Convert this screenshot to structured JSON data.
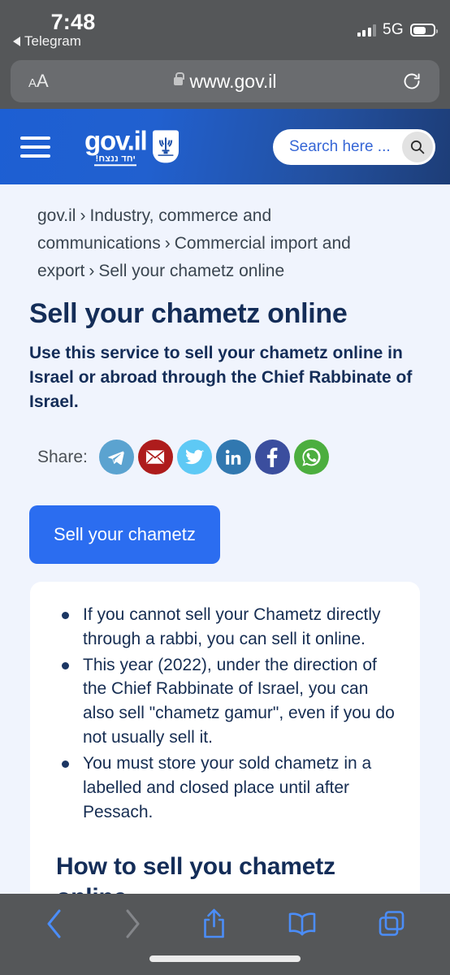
{
  "status_bar": {
    "time": "7:48",
    "back_app_label": "Telegram",
    "back_app_icon": "triangle-left-icon",
    "signal_icon": "cellular-signal-icon",
    "network": "5G",
    "battery_icon": "battery-icon",
    "battery_level_percent": 58
  },
  "browser": {
    "text_size_small": "A",
    "text_size_large": "A",
    "lock_icon": "lock-icon",
    "url": "www.gov.il",
    "reload_icon": "reload-icon",
    "toolbar": {
      "back_icon": "chevron-left-icon",
      "forward_icon": "chevron-right-icon",
      "share_icon": "share-icon",
      "bookmarks_icon": "book-icon",
      "tabs_icon": "tabs-icon"
    },
    "colors": {
      "chrome_bg": "#555759",
      "accent": "#4b8df8",
      "disabled": "#8b8d8f"
    }
  },
  "site_header": {
    "menu_icon": "hamburger-menu-icon",
    "logo_text": "gov.il",
    "logo_subtext": "יחד ננצח!",
    "emblem_icon": "israel-emblem-icon",
    "search_placeholder": "Search here ...",
    "search_icon": "search-icon",
    "gradient_from": "#1d5fd3",
    "gradient_to": "#1d3d77"
  },
  "breadcrumb": {
    "separator": "›",
    "items": [
      {
        "label": "gov.il"
      },
      {
        "label": "Industry, commerce and communications"
      },
      {
        "label": "Commercial import and export"
      },
      {
        "label": "Sell your chametz online"
      }
    ]
  },
  "main": {
    "title": "Sell your chametz online",
    "description": "Use this service to sell your chametz online in Israel or abroad through the Chief Rabbinate of Israel.",
    "share": {
      "label": "Share:",
      "items": [
        {
          "name": "telegram",
          "icon": "telegram-icon",
          "color": "#5ba3d0"
        },
        {
          "name": "email",
          "icon": "email-icon",
          "color": "#ae1c1c"
        },
        {
          "name": "twitter",
          "icon": "twitter-icon",
          "color": "#5ec9f5"
        },
        {
          "name": "linkedin",
          "icon": "linkedin-icon",
          "color": "#3178b0"
        },
        {
          "name": "facebook",
          "icon": "facebook-icon",
          "color": "#3b4e9e"
        },
        {
          "name": "whatsapp",
          "icon": "whatsapp-icon",
          "color": "#4cae3f"
        }
      ]
    },
    "cta_label": "Sell your chametz",
    "cta_color": "#2b6df0",
    "card": {
      "bullets": [
        "If you cannot sell your Chametz directly through a rabbi, you can sell it online.",
        "This year (2022), under the direction of the Chief Rabbinate of Israel, you can also sell \"chametz gamur\", even if you do not usually sell it.",
        "You must store your sold chametz in a labelled and closed place until after Pessach."
      ],
      "section_heading": "How to sell you chametz online"
    }
  },
  "page_background": "#f0f4fd",
  "text_color": "#142d58"
}
